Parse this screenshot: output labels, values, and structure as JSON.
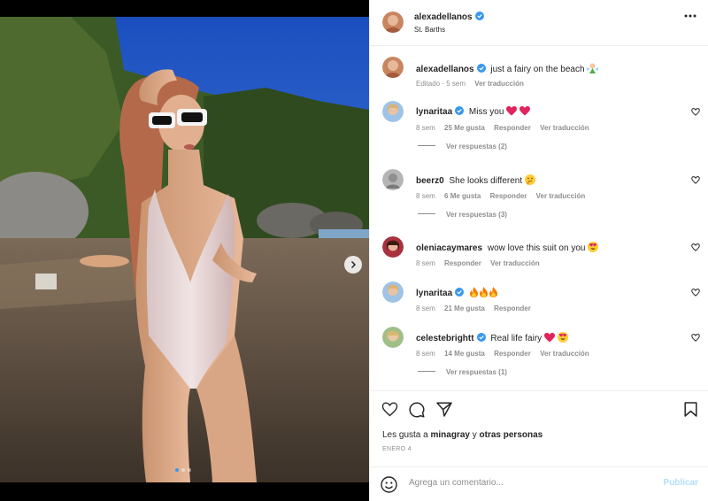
{
  "post": {
    "username": "alexadellanos",
    "location": "St. Barths",
    "caption_user": "alexadellanos",
    "caption_text": "just a fairy on the beach",
    "caption_emoji": "fairy-emoji",
    "caption_edited": "Editado · 5 sem",
    "caption_translate": "Ver traducción"
  },
  "carousel": {
    "slides": 3,
    "active_slide": 1
  },
  "comments": [
    {
      "user": "lynaritaa",
      "verified": true,
      "text": "Miss you",
      "emojis": [
        "red-heart",
        "red-heart"
      ],
      "time": "8 sem",
      "likes": "25 Me gusta",
      "reply": "Responder",
      "translate": "Ver traducción",
      "replies": "Ver respuestas (2)"
    },
    {
      "user": "beerz0",
      "verified": false,
      "text": "She looks different",
      "emojis": [
        "thinking-face"
      ],
      "time": "8 sem",
      "likes": "6 Me gusta",
      "reply": "Responder",
      "translate": "Ver traducción",
      "replies": "Ver respuestas (3)"
    },
    {
      "user": "oleniacaymares",
      "verified": false,
      "text": "wow love this suit on you",
      "emojis": [
        "heart-eyes-face"
      ],
      "time": "8 sem",
      "likes": "",
      "reply": "Responder",
      "translate": "Ver traducción",
      "replies": ""
    },
    {
      "user": "lynaritaa",
      "verified": true,
      "text": "",
      "emojis": [
        "fire",
        "fire",
        "fire"
      ],
      "time": "8 sem",
      "likes": "21 Me gusta",
      "reply": "Responder",
      "translate": "",
      "replies": ""
    },
    {
      "user": "celestebrightt",
      "verified": true,
      "text": "Real life fairy",
      "emojis": [
        "red-heart",
        "heart-eyes-face"
      ],
      "time": "8 sem",
      "likes": "14 Me gusta",
      "reply": "Responder",
      "translate": "Ver traducción",
      "replies": "Ver respuestas (1)"
    }
  ],
  "footer": {
    "likes_prefix": "Les gusta a",
    "likes_user": "minagray",
    "likes_connector": "y",
    "likes_others": "otras personas",
    "date": "ENERO 4",
    "comment_placeholder": "Agrega un comentario...",
    "post_label": "Publicar"
  },
  "colors": {
    "verified": "#3897f0",
    "muted": "#8e8e8e",
    "text": "#262626",
    "post_disabled": "#b2dffc",
    "border": "#efefef"
  },
  "icons": {
    "more": "more-options-icon",
    "like": "heart-outline-icon",
    "comment": "comment-bubble-icon",
    "share": "paper-plane-icon",
    "save": "bookmark-icon",
    "emoji": "smiley-icon",
    "next": "chevron-right-icon"
  }
}
